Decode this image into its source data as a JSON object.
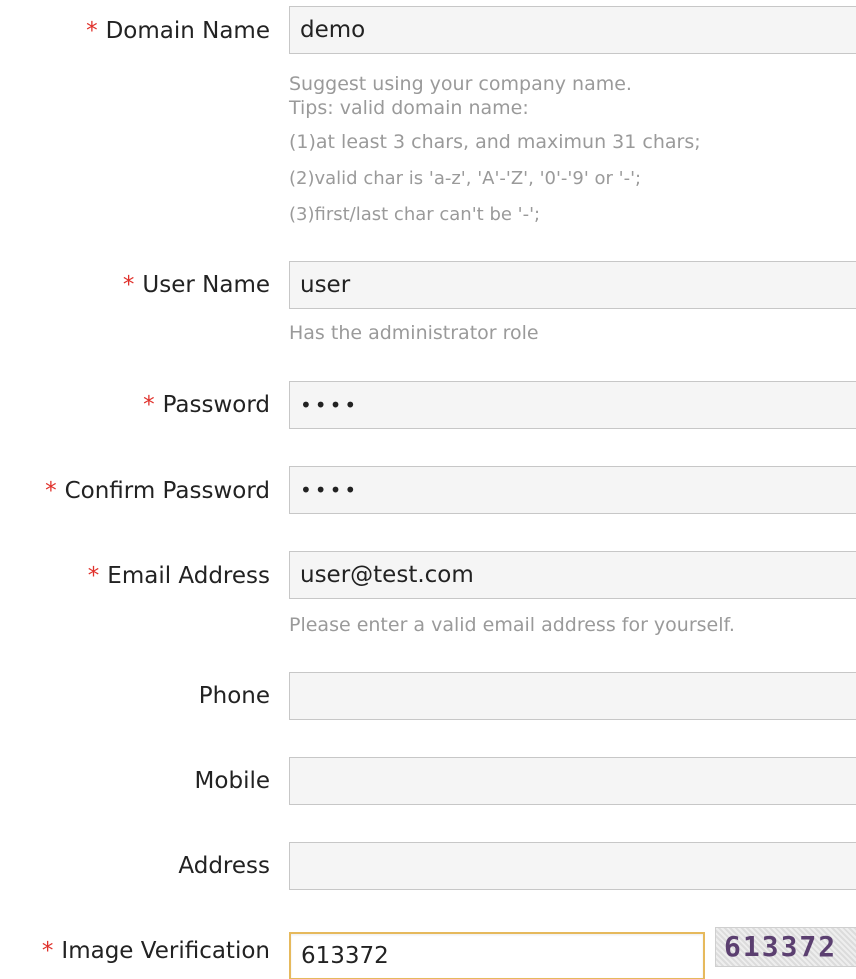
{
  "required_marker": "*",
  "fields": {
    "domain_name": {
      "label": "Domain Name",
      "value": "demo",
      "hints": [
        "Suggest using your company name.",
        "Tips: valid domain name:",
        "(1)at least 3 chars, and maximun 31 chars;",
        "(2)valid char is 'a-z', 'A'-'Z', '0'-'9' or '-';",
        "(3)first/last char can't be '-';"
      ]
    },
    "user_name": {
      "label": "User Name",
      "value": "user",
      "hint": "Has the administrator role"
    },
    "password": {
      "label": "Password",
      "value": "••••"
    },
    "confirm_password": {
      "label": "Confirm Password",
      "value": "••••"
    },
    "email": {
      "label": "Email Address",
      "value": "user@test.com",
      "hint": "Please enter a valid email address for yourself."
    },
    "phone": {
      "label": "Phone",
      "value": ""
    },
    "mobile": {
      "label": "Mobile",
      "value": ""
    },
    "address": {
      "label": "Address",
      "value": ""
    },
    "image_verification": {
      "label": "Image Verification",
      "value": "613372",
      "captcha_text": "613372"
    }
  },
  "colors": {
    "required": "#e0312b",
    "hint": "#9a9a9a",
    "active_border": "#e6b95c"
  }
}
